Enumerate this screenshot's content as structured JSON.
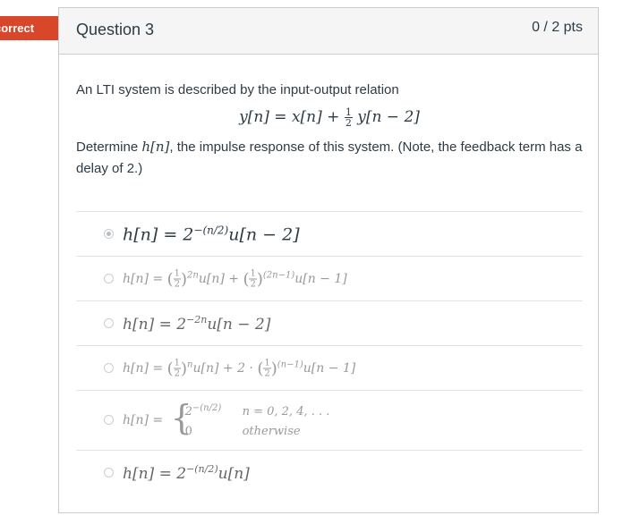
{
  "banner": {
    "label": "correct"
  },
  "question": {
    "title": "Question 3",
    "points": "0 / 2 pts",
    "intro": "An LTI system is described by the input-output relation",
    "equation": {
      "lhs": "y[n] = x[n] + ",
      "frac_num": "1",
      "frac_den": "2",
      "rhs": "y[n − 2]"
    },
    "determine_pre": "Determine ",
    "determine_var": "h[n]",
    "determine_post": ", the impulse response of this system.  (Note, the feedback term has a delay of 2.)"
  },
  "answers": [
    {
      "selected": true,
      "text_a": "h[n] = 2",
      "sup_a": "−(n/2)",
      "text_b": "u[n − 2]"
    },
    {
      "selected": false,
      "h": "h[n] = ",
      "f1_num": "1",
      "f1_den": "2",
      "sup1": "2n",
      "mid": "u[n] + ",
      "f2_num": "1",
      "f2_den": "2",
      "sup2": "(2n−1)",
      "tail": "u[n − 1]"
    },
    {
      "selected": false,
      "text_a": "h[n] = 2",
      "sup_a": "−2n",
      "text_b": "u[n − 2]"
    },
    {
      "selected": false,
      "h": "h[n] = ",
      "f1_num": "1",
      "f1_den": "2",
      "sup1": "n",
      "mid": "u[n] + 2 · ",
      "f2_num": "1",
      "f2_den": "2",
      "sup2": "(n−1)",
      "tail": "u[n − 1]"
    },
    {
      "selected": false,
      "h": "h[n] = ",
      "case1_base": "2",
      "case1_sup": "−(n/2)",
      "case1_cond": "n = 0, 2, 4, . . .",
      "case2_val": "0",
      "case2_cond": "otherwise"
    },
    {
      "selected": false,
      "text_a": "h[n] = 2",
      "sup_a": "−(n/2)",
      "text_b": "u[n]"
    }
  ]
}
